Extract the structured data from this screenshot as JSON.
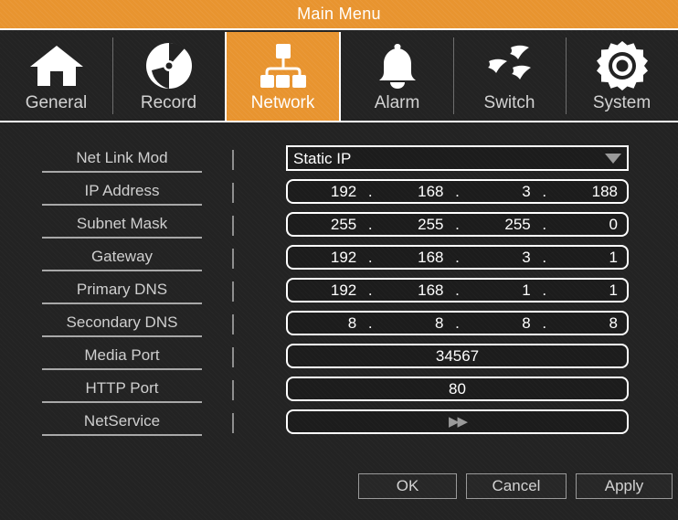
{
  "window": {
    "title": "Main Menu",
    "accent_color": "#e8942f",
    "background_color": "#232323",
    "border_color": "#ffffff",
    "text_color": "#cfcfcf"
  },
  "tabs": [
    {
      "label": "General",
      "icon": "home-icon",
      "active": false
    },
    {
      "label": "Record",
      "icon": "disc-icon",
      "active": false
    },
    {
      "label": "Network",
      "icon": "network-icon",
      "active": true
    },
    {
      "label": "Alarm",
      "icon": "bell-icon",
      "active": false
    },
    {
      "label": "Switch",
      "icon": "birds-icon",
      "active": false
    },
    {
      "label": "System",
      "icon": "gear-icon",
      "active": false
    }
  ],
  "form": {
    "rows": [
      {
        "label": "Net Link Mod",
        "type": "select",
        "value": "Static IP"
      },
      {
        "label": "IP Address",
        "type": "ip",
        "octets": [
          "192",
          "168",
          "3",
          "188"
        ]
      },
      {
        "label": "Subnet Mask",
        "type": "ip",
        "octets": [
          "255",
          "255",
          "255",
          "0"
        ]
      },
      {
        "label": "Gateway",
        "type": "ip",
        "octets": [
          "192",
          "168",
          "3",
          "1"
        ]
      },
      {
        "label": "Primary DNS",
        "type": "ip",
        "octets": [
          "192",
          "168",
          "1",
          "1"
        ]
      },
      {
        "label": "Secondary DNS",
        "type": "ip",
        "octets": [
          "8",
          "8",
          "8",
          "8"
        ]
      },
      {
        "label": "Media Port",
        "type": "text",
        "value": "34567"
      },
      {
        "label": "HTTP Port",
        "type": "text",
        "value": "80"
      },
      {
        "label": "NetService",
        "type": "link",
        "value": "▶▶"
      }
    ],
    "separator": "."
  },
  "footer": {
    "ok_label": "OK",
    "cancel_label": "Cancel",
    "apply_label": "Apply"
  }
}
